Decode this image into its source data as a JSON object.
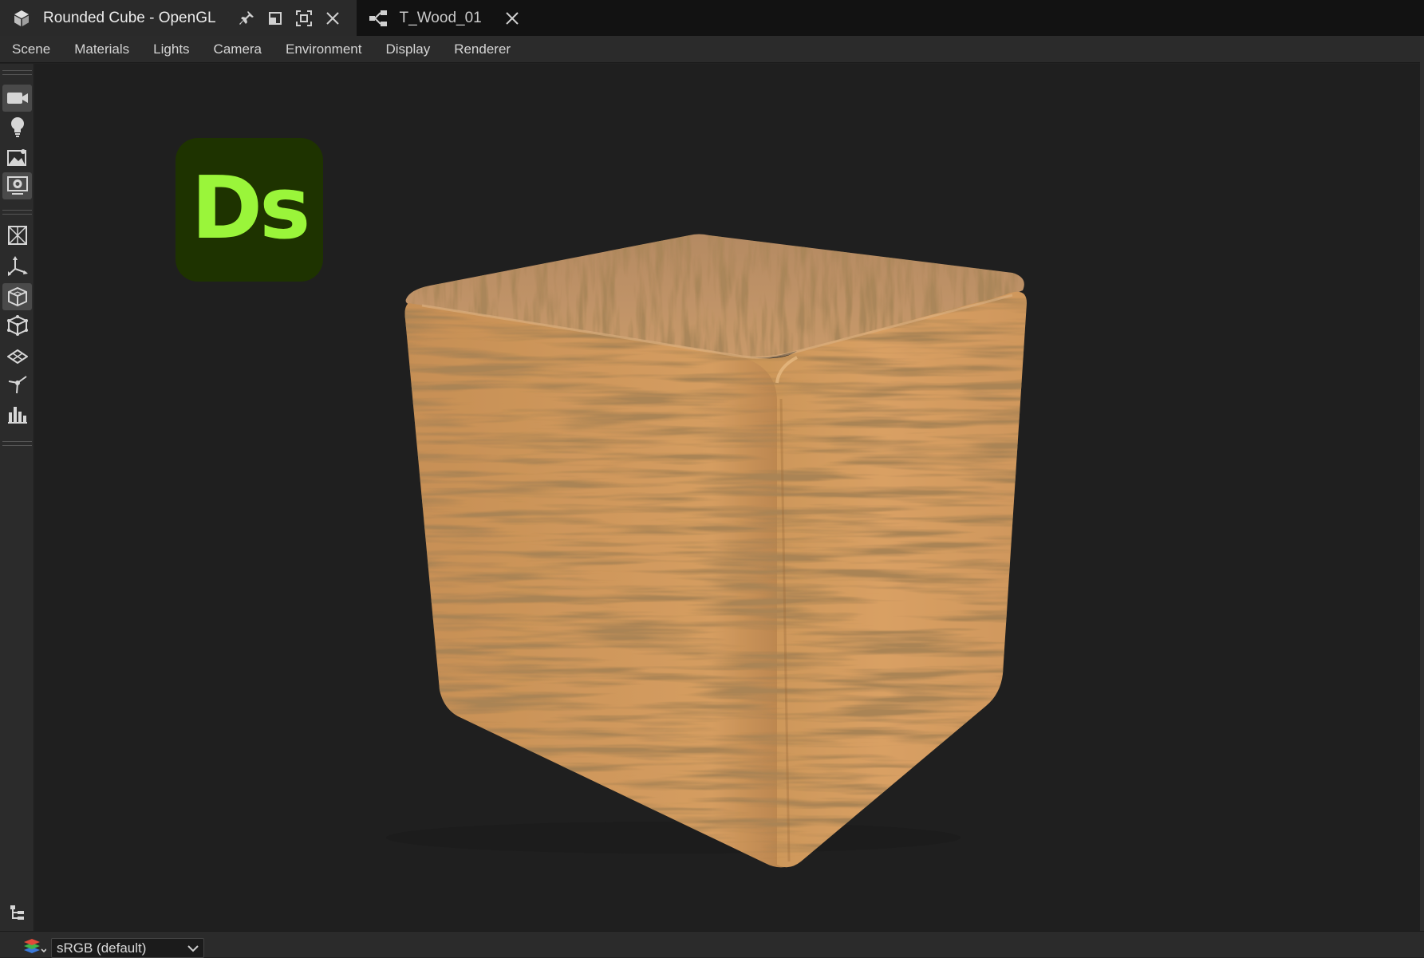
{
  "tabs": [
    {
      "title": "Rounded Cube - OpenGL",
      "active": true,
      "icon": "cube-icon"
    },
    {
      "title": "T_Wood_01",
      "active": false,
      "icon": "node-graph-icon"
    }
  ],
  "menu": [
    "Scene",
    "Materials",
    "Lights",
    "Camera",
    "Environment",
    "Display",
    "Renderer"
  ],
  "toolbar": {
    "tools": [
      "camera-icon",
      "light-bulb-icon",
      "environment-image-icon",
      "render-settings-icon",
      "wireframe-cube-icon",
      "axis-gizmo-icon",
      "solid-cube-icon",
      "mesh-cube-icon",
      "plane-icon",
      "light-source-icon",
      "histogram-icon"
    ]
  },
  "viewport": {
    "logo_text": "Ds",
    "logo_bg": "#1e3300",
    "logo_fg": "#9af53a",
    "material": "wood"
  },
  "status": {
    "colorspace": "sRGB (default)"
  },
  "colors": {
    "tabbar_bg": "#121212",
    "active_tab_bg": "#2a2a2a",
    "panel_bg": "#2b2b2b",
    "viewport_bg": "#1f1f1f",
    "wood_light": "#d39a5c",
    "wood_dark": "#8a5a2e"
  }
}
